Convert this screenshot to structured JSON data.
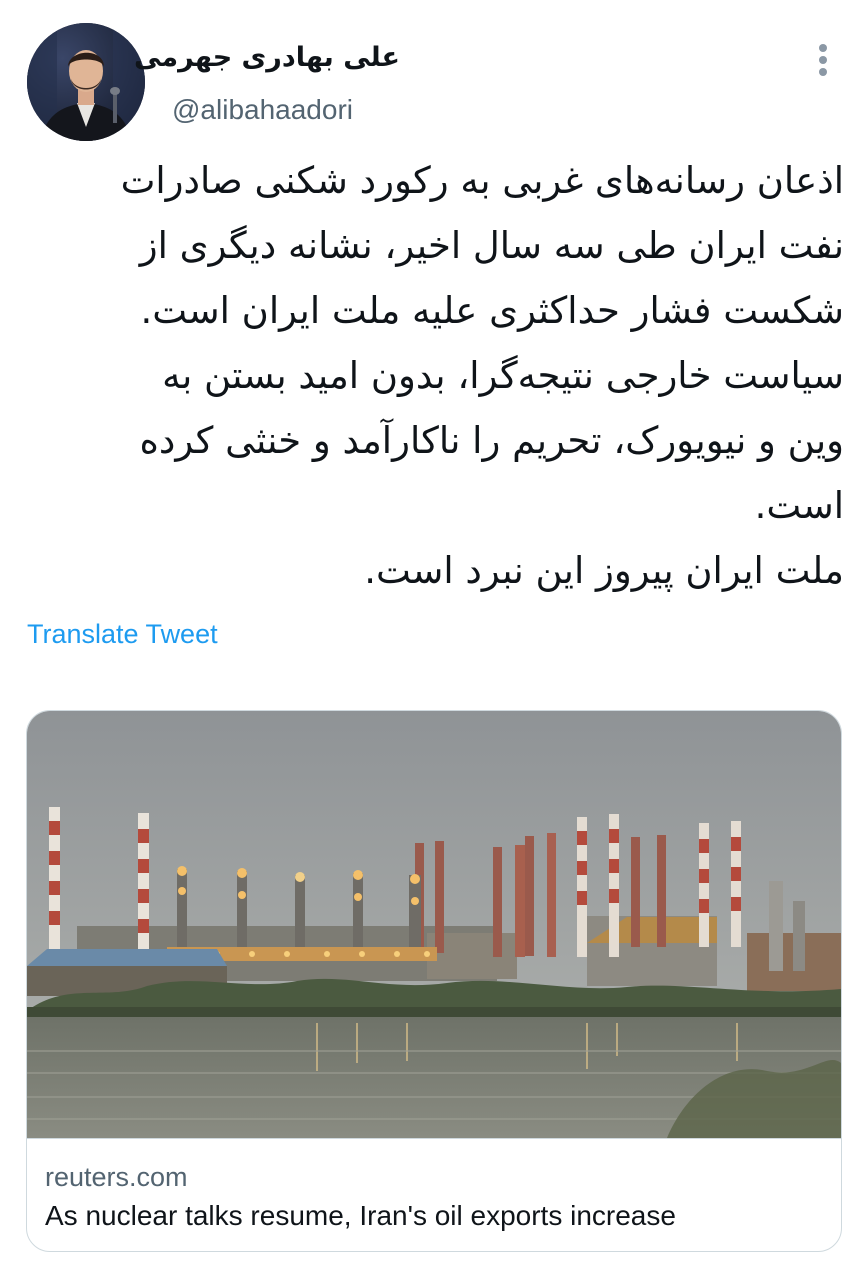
{
  "author": {
    "display_name": "علی بهادری جهرمی",
    "handle": "@alibahaadori"
  },
  "tweet": {
    "lines": [
      "اذعان رسانه‌های غربی به رکورد شکنی صادرات",
      "نفت ایران طی سه سال اخیر، نشانه دیگری از",
      "شکست فشار حداکثری علیه ملت ایران است.",
      "سیاست خارجی نتیجه‌گرا، بدون امید بستن به",
      "وین و نیویورک، تحریم را ناکارآمد و خنثی کرده",
      "است.",
      "ملت ایران پیروز این نبرد است."
    ],
    "translate_label": "Translate Tweet"
  },
  "card": {
    "domain": "reuters.com",
    "title": "As nuclear talks resume, Iran's oil exports increase",
    "image_icon": "oil-refinery-photo"
  },
  "icons": {
    "more": "more-options-icon"
  },
  "colors": {
    "link": "#1d9bf0",
    "secondary_text": "#536471",
    "border": "#cfd9de"
  }
}
